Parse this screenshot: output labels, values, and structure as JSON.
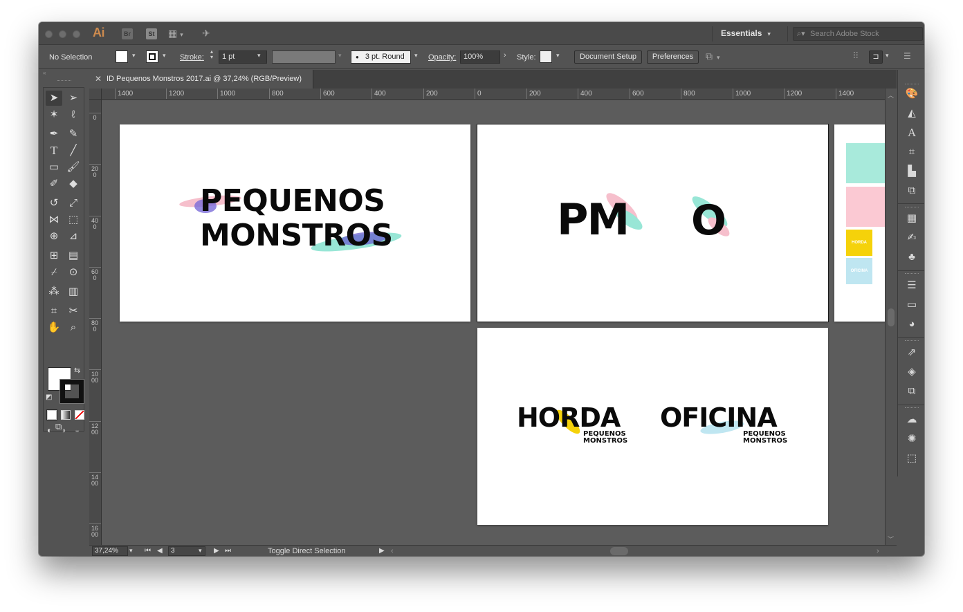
{
  "app": {
    "logo": "Ai",
    "badges": [
      "Br",
      "St"
    ]
  },
  "titlebar": {
    "workspace": "Essentials",
    "search_placeholder": "Search Adobe Stock"
  },
  "controlbar": {
    "selection": "No Selection",
    "stroke_label": "Stroke:",
    "stroke_weight": "1 pt",
    "brush": "3 pt. Round",
    "opacity_label": "Opacity:",
    "opacity_value": "100%",
    "style_label": "Style:",
    "document_setup": "Document Setup",
    "preferences": "Preferences"
  },
  "document_tab": {
    "title": "ID Pequenos Monstros 2017.ai @ 37,24% (RGB/Preview)"
  },
  "ruler_top": [
    "1400",
    "1200",
    "1000",
    "800",
    "600",
    "400",
    "200",
    "0",
    "200",
    "400",
    "600",
    "800",
    "1000",
    "1200",
    "1400"
  ],
  "ruler_left": [
    "0",
    "200",
    "400",
    "600",
    "800",
    "1000",
    "1200",
    "1400",
    "1600"
  ],
  "artboards": {
    "logo_line1": "PEQUENOS",
    "logo_line2": "MONSTROS",
    "monogram_left": "PM",
    "monogram_right": "O",
    "horda": "HORDA",
    "horda_sub1": "PEQUENOS",
    "horda_sub2": "MONSTROS",
    "oficina": "OFICINA",
    "oficina_sub1": "PEQUENOS",
    "oficina_sub2": "MONSTROS",
    "palette_horda": "HORDA",
    "palette_oficina": "OFICINA"
  },
  "palette_colors": {
    "mint": "#a8eadb",
    "pink": "#fbc9d3",
    "yellow": "#f5d20a",
    "lightblue": "#bfe6f1"
  },
  "statusbar": {
    "zoom": "37,24%",
    "artboard_number": "3",
    "status": "Toggle Direct Selection"
  }
}
